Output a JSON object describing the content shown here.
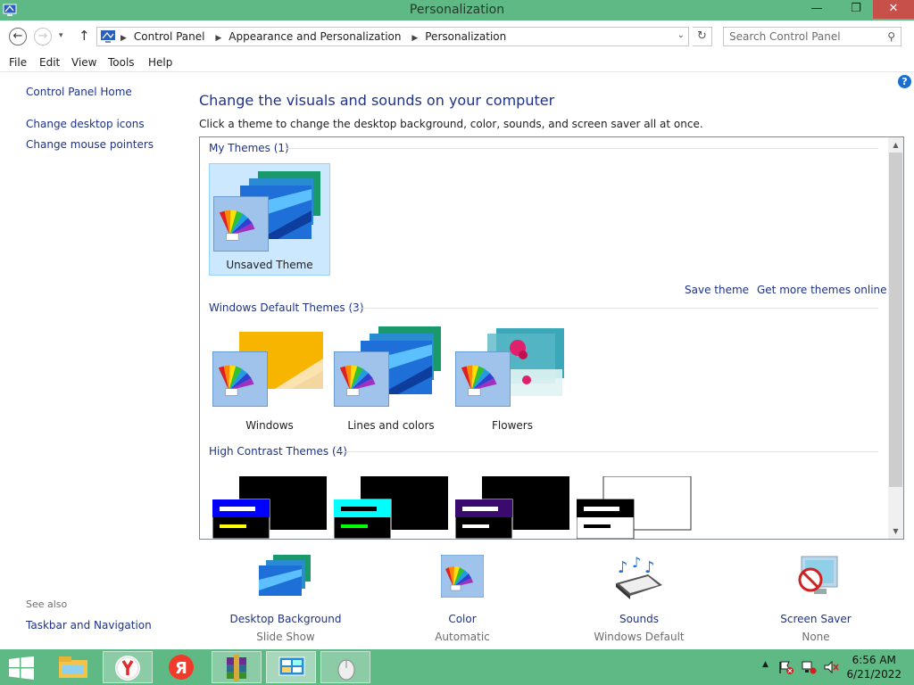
{
  "window": {
    "title": "Personalization"
  },
  "window_controls": {
    "minimize": "—",
    "maximize": "❐",
    "close": "✕"
  },
  "address": {
    "breadcrumbs": [
      "Control Panel",
      "Appearance and Personalization",
      "Personalization"
    ],
    "search_placeholder": "Search Control Panel"
  },
  "menu": [
    "File",
    "Edit",
    "View",
    "Tools",
    "Help"
  ],
  "left_pane": {
    "home": "Control Panel Home",
    "links": [
      "Change desktop icons",
      "Change mouse pointers"
    ],
    "see_also_title": "See also",
    "see_also_links": [
      "Taskbar and Navigation"
    ]
  },
  "main": {
    "heading": "Change the visuals and sounds on your computer",
    "subtext": "Click a theme to change the desktop background, color, sounds, and screen saver all at once."
  },
  "groups": {
    "my_themes": "My Themes (1)",
    "default_themes": "Windows Default Themes (3)",
    "high_contrast": "High Contrast Themes (4)"
  },
  "themes": {
    "unsaved": "Unsaved Theme",
    "windows": "Windows",
    "lines": "Lines and colors",
    "flowers": "Flowers"
  },
  "panel_links": {
    "save": "Save theme",
    "more": "Get more themes online"
  },
  "bottom": [
    {
      "label": "Desktop Background",
      "sub": "Slide Show"
    },
    {
      "label": "Color",
      "sub": "Automatic"
    },
    {
      "label": "Sounds",
      "sub": "Windows Default"
    },
    {
      "label": "Screen Saver",
      "sub": "None"
    }
  ],
  "clock": {
    "time": "6:56 AM",
    "date": "6/21/2022"
  },
  "icons": {
    "help": "?",
    "search": "⚲",
    "refresh": "↻",
    "back": "←",
    "forward": "→",
    "up": "↑",
    "dropdown": "▾"
  },
  "colors": {
    "titlebar": "#5fb984",
    "link": "#1e3287",
    "selected_bg": "#cce8ff",
    "selected_border": "#99d1ff"
  }
}
